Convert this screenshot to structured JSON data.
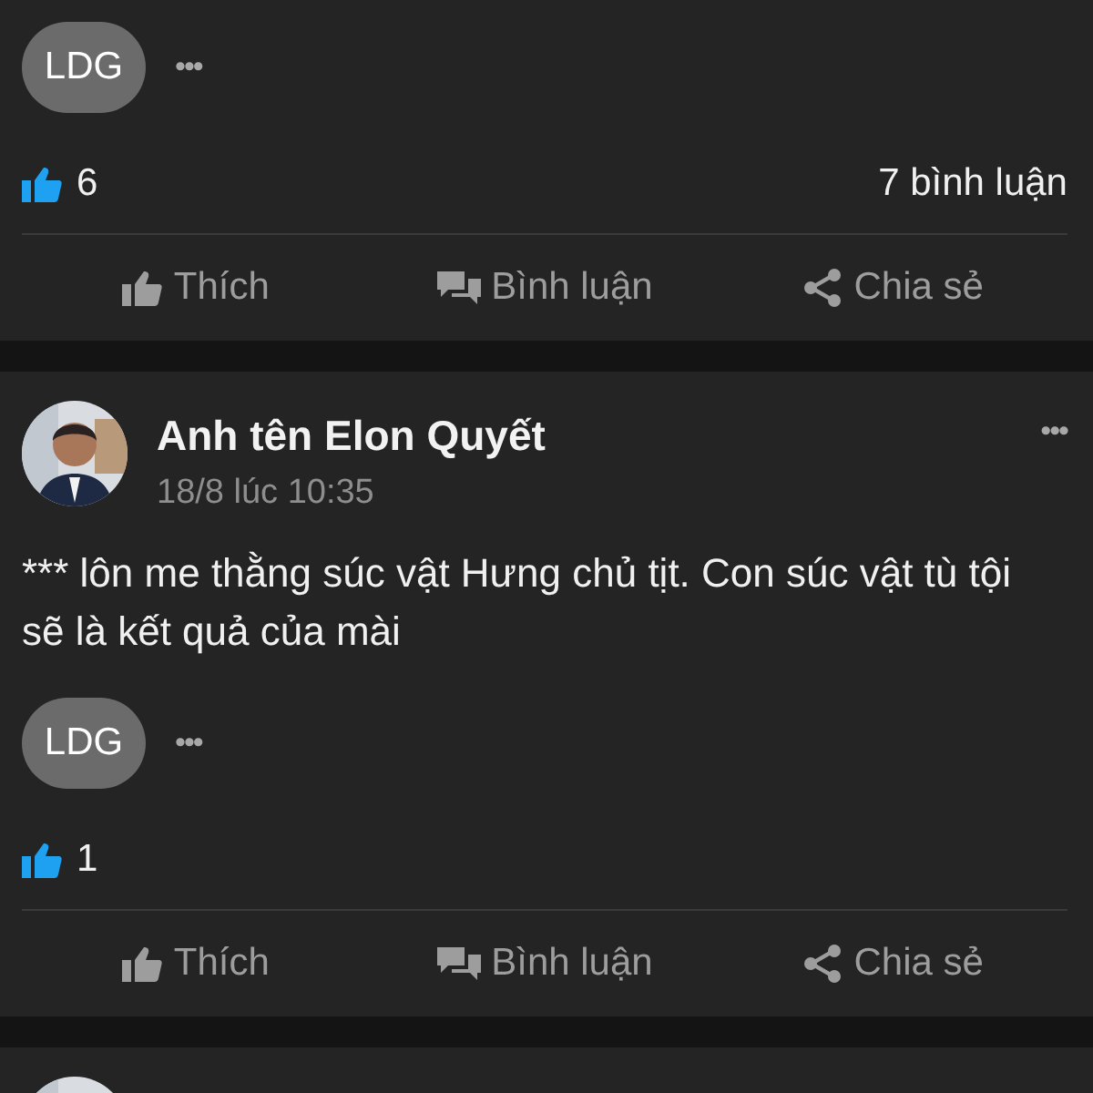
{
  "posts": [
    {
      "reaction_chip": "LDG",
      "more": "•••",
      "like_count": "6",
      "comment_count": "7 bình luận",
      "actions": [
        {
          "kind": "like",
          "label": "Thích"
        },
        {
          "kind": "comment",
          "label": "Bình luận"
        },
        {
          "kind": "share",
          "label": "Chia sẻ"
        }
      ]
    },
    {
      "author": "Anh tên Elon Quyết",
      "time": "18/8 lúc 10:35",
      "menu": "•••",
      "avatar": {
        "kind": "picture"
      },
      "text": "*** lôn me thằng súc vật Hưng chủ tịt. Con súc vật tù tội sẽ là kết quả của mài",
      "reaction_chip": "LDG",
      "more": "•••",
      "like_count": "1",
      "actions": [
        {
          "kind": "like",
          "label": "Thích"
        },
        {
          "kind": "comment",
          "label": "Bình luận"
        },
        {
          "kind": "share",
          "label": "Chia sẻ"
        }
      ]
    },
    {
      "avatar": {
        "kind": "picture"
      }
    }
  ]
}
